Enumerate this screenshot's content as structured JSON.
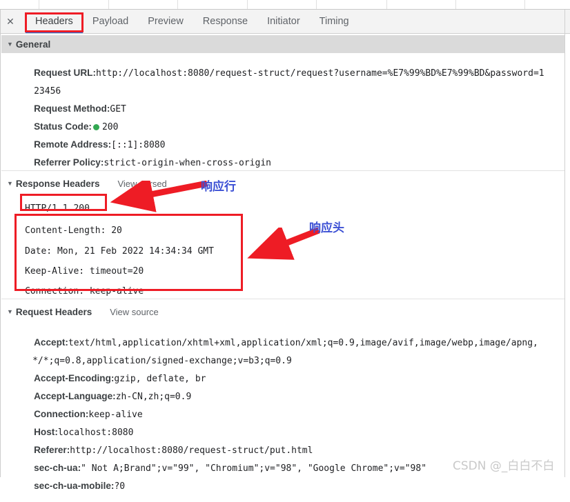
{
  "colors": {
    "accent": "#1a73e8",
    "annotation_red": "#ee1c25",
    "annotation_blue": "#3b4fd4",
    "status_green": "#33a852",
    "section_bar": "#dadada",
    "tabstrip_bg": "#f3f3f3"
  },
  "tabstrip": {
    "close_label": "✕",
    "tabs": [
      {
        "label": "Headers",
        "selected": true
      },
      {
        "label": "Payload",
        "selected": false
      },
      {
        "label": "Preview",
        "selected": false
      },
      {
        "label": "Response",
        "selected": false
      },
      {
        "label": "Initiator",
        "selected": false
      },
      {
        "label": "Timing",
        "selected": false
      }
    ]
  },
  "general": {
    "title": "General",
    "triangle": "▼",
    "rows": [
      {
        "name": "Request URL:",
        "value": "http://localhost:8080/request-struct/request?username=%E7%99%BD%E7%99%BD&password=1",
        "wrap": "23456"
      },
      {
        "name": "Request Method:",
        "value": "GET"
      },
      {
        "name": "Status Code:",
        "value": "200",
        "status_dot": true
      },
      {
        "name": "Remote Address:",
        "value": "[::1]:8080"
      },
      {
        "name": "Referrer Policy:",
        "value": "strict-origin-when-cross-origin"
      }
    ]
  },
  "response_headers": {
    "title": "Response Headers",
    "triangle": "▼",
    "action": "View parsed",
    "status_line": "HTTP/1.1 200",
    "lines": [
      "Content-Length: 20",
      "Date: Mon, 21 Feb 2022 14:34:34 GMT",
      "Keep-Alive: timeout=20",
      "Connection: keep-alive"
    ]
  },
  "request_headers": {
    "title": "Request Headers",
    "triangle": "▼",
    "action": "View source",
    "rows": [
      {
        "name": "Accept:",
        "value": "text/html,application/xhtml+xml,application/xml;q=0.9,image/avif,image/webp,image/apng,",
        "wrap": "*/*;q=0.8,application/signed-exchange;v=b3;q=0.9"
      },
      {
        "name": "Accept-Encoding:",
        "value": "gzip, deflate, br"
      },
      {
        "name": "Accept-Language:",
        "value": "zh-CN,zh;q=0.9"
      },
      {
        "name": "Connection:",
        "value": "keep-alive"
      },
      {
        "name": "Host:",
        "value": "localhost:8080"
      },
      {
        "name": "Referer:",
        "value": "http://localhost:8080/request-struct/put.html"
      },
      {
        "name": "sec-ch-ua:",
        "value": "\" Not A;Brand\";v=\"99\", \"Chromium\";v=\"98\", \"Google Chrome\";v=\"98\""
      },
      {
        "name": "sec-ch-ua-mobile:",
        "value": "?0"
      }
    ]
  },
  "annotations": {
    "response_line_label": "响应行",
    "response_headers_label": "响应头"
  },
  "watermark": {
    "text": "CSDN @_白白不白"
  }
}
